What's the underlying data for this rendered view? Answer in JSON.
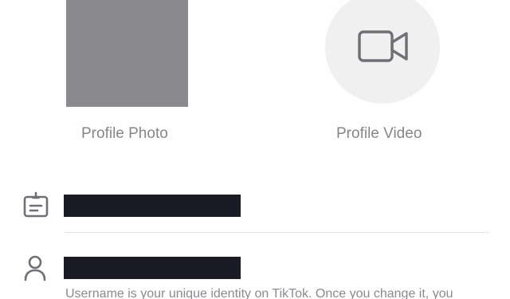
{
  "media": {
    "photo_label": "Profile Photo",
    "video_label": "Profile Video"
  },
  "fields": {
    "name": {
      "icon": "id-card-icon",
      "value_redacted": true
    },
    "username": {
      "icon": "person-icon",
      "value_redacted": true,
      "helper": "Username is your unique identity on TikTok. Once you change it, you"
    }
  },
  "colors": {
    "redaction": "#1a1b24",
    "label": "#86878b",
    "icon": "#6f7075",
    "photo_placeholder": "#8a8a8e",
    "video_bg": "#f0f0f1"
  }
}
